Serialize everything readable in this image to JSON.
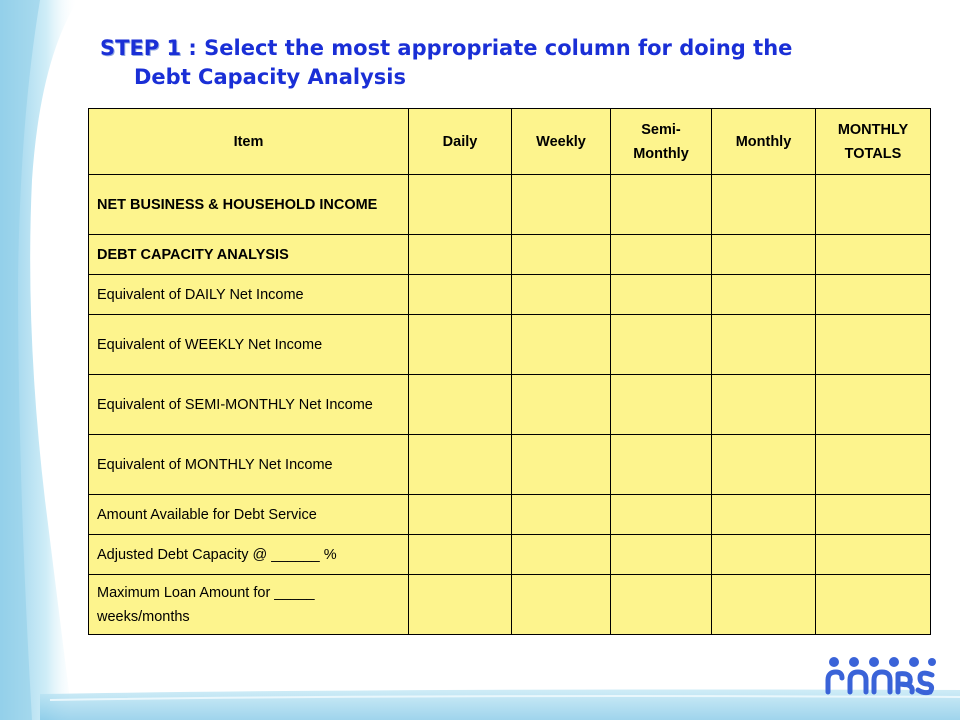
{
  "slide": {
    "title_step": "STEP 1",
    "title_rest": " : Select the most appropriate column for doing the",
    "title_line2": "Debt Capacity Analysis"
  },
  "table": {
    "headers": [
      "Item",
      "Daily",
      "Weekly",
      "Semi-Monthly",
      "Monthly",
      "MONTHLY TOTALS"
    ],
    "rows": [
      {
        "label": "NET BUSINESS & HOUSEHOLD INCOME"
      },
      {
        "label": "DEBT CAPACITY ANALYSIS"
      },
      {
        "label": "Equivalent of DAILY Net Income"
      },
      {
        "label": "Equivalent of WEEKLY Net Income"
      },
      {
        "label": "Equivalent of SEMI-MONTHLY Net Income"
      },
      {
        "label": "Equivalent of MONTHLY Net Income"
      },
      {
        "label": "Amount Available for Debt Service"
      },
      {
        "label": "Adjusted Debt Capacity @ ______ %"
      },
      {
        "label": "Maximum Loan Amount for _____ weeks/months"
      }
    ]
  },
  "colors": {
    "title": "#1a2fd6",
    "table_fill": "#fdf48d",
    "decor_blue": "#a9dcef"
  },
  "logo": {
    "name": "rimans-logo-icon"
  }
}
